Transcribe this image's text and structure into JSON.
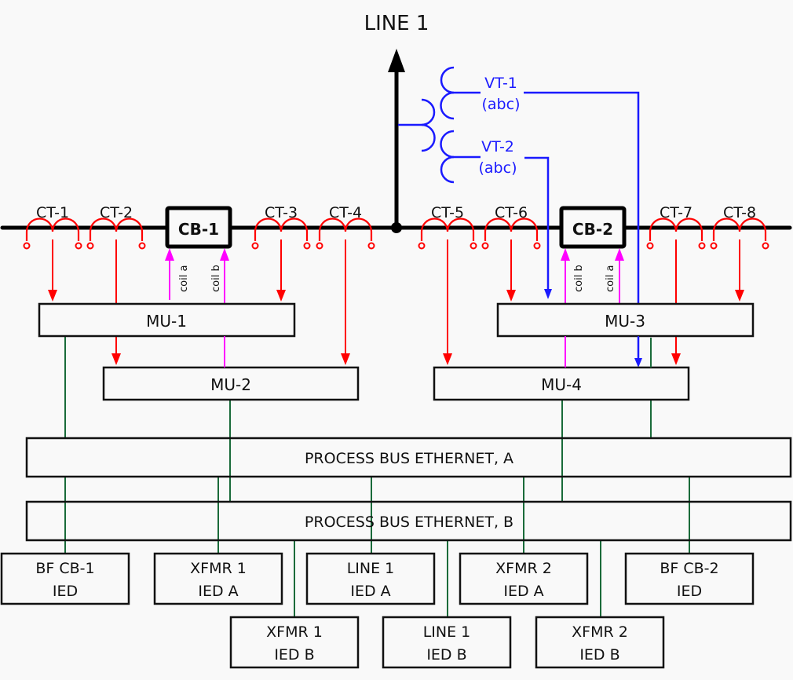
{
  "diagram": {
    "line_label": "LINE 1",
    "colors": {
      "bus": "#000000",
      "ct": "#ff0000",
      "vt": "#1a1aff",
      "trip": "#ff00ff",
      "ethernet": "#1a6b3a",
      "box": "#111111",
      "background": "#f9f9f9"
    },
    "cts": [
      {
        "id": "CT-1",
        "label": "CT-1"
      },
      {
        "id": "CT-2",
        "label": "CT-2"
      },
      {
        "id": "CT-3",
        "label": "CT-3"
      },
      {
        "id": "CT-4",
        "label": "CT-4"
      },
      {
        "id": "CT-5",
        "label": "CT-5"
      },
      {
        "id": "CT-6",
        "label": "CT-6"
      },
      {
        "id": "CT-7",
        "label": "CT-7"
      },
      {
        "id": "CT-8",
        "label": "CT-8"
      }
    ],
    "breakers": [
      {
        "id": "CB-1",
        "label": "CB-1",
        "coils": [
          "coil a",
          "coil b"
        ]
      },
      {
        "id": "CB-2",
        "label": "CB-2",
        "coils": [
          "coil b",
          "coil a"
        ]
      }
    ],
    "vts": [
      {
        "id": "VT-1",
        "label": "VT-1",
        "phase": "(abc)"
      },
      {
        "id": "VT-2",
        "label": "VT-2",
        "phase": "(abc)"
      }
    ],
    "merging_units": [
      {
        "id": "MU-1",
        "label": "MU-1"
      },
      {
        "id": "MU-2",
        "label": "MU-2"
      },
      {
        "id": "MU-3",
        "label": "MU-3"
      },
      {
        "id": "MU-4",
        "label": "MU-4"
      }
    ],
    "networks": [
      {
        "id": "PB-A",
        "label": "PROCESS BUS ETHERNET, A"
      },
      {
        "id": "PB-B",
        "label": "PROCESS BUS ETHERNET, B"
      }
    ],
    "ieds": [
      {
        "id": "bf-cb1",
        "line1": "BF CB-1",
        "line2": "IED"
      },
      {
        "id": "xfmr1-a",
        "line1": "XFMR 1",
        "line2": "IED A"
      },
      {
        "id": "line1-a",
        "line1": "LINE 1",
        "line2": "IED A"
      },
      {
        "id": "xfmr2-a",
        "line1": "XFMR 2",
        "line2": "IED A"
      },
      {
        "id": "bf-cb2",
        "line1": "BF CB-2",
        "line2": "IED"
      },
      {
        "id": "xfmr1-b",
        "line1": "XFMR 1",
        "line2": "IED B"
      },
      {
        "id": "line1-b",
        "line1": "LINE 1",
        "line2": "IED B"
      },
      {
        "id": "xfmr2-b",
        "line1": "XFMR 2",
        "line2": "IED B"
      }
    ]
  }
}
